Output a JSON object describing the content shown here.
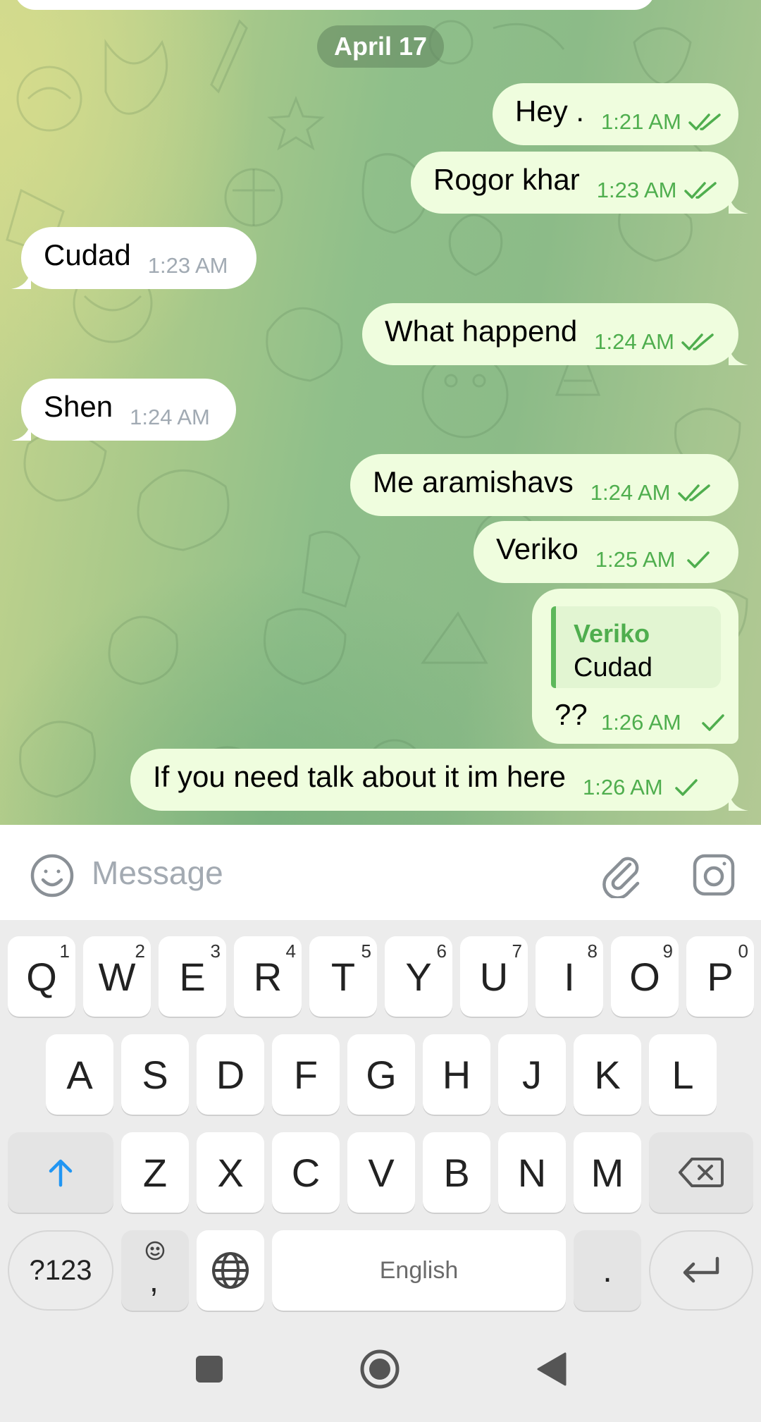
{
  "chat": {
    "date_chip": "April 17",
    "messages": [
      {
        "id": "m1",
        "dir": "out",
        "text": "Hey .",
        "time": "1:21 AM",
        "ticks": "double"
      },
      {
        "id": "m2",
        "dir": "out",
        "text": "Rogor khar",
        "time": "1:23 AM",
        "ticks": "double"
      },
      {
        "id": "m3",
        "dir": "in",
        "text": "Cudad",
        "time": "1:23 AM"
      },
      {
        "id": "m4",
        "dir": "out",
        "text": "What happend",
        "time": "1:24 AM",
        "ticks": "double"
      },
      {
        "id": "m5",
        "dir": "in",
        "text": "Shen",
        "time": "1:24 AM"
      },
      {
        "id": "m6",
        "dir": "out",
        "text": "Me aramishavs",
        "time": "1:24 AM",
        "ticks": "double"
      },
      {
        "id": "m7",
        "dir": "out",
        "text": "Veriko",
        "time": "1:25 AM",
        "ticks": "single"
      },
      {
        "id": "m8",
        "dir": "out",
        "text": "??",
        "time": "1:26 AM",
        "ticks": "single",
        "reply_to": {
          "name": "Veriko",
          "text": "Cudad"
        }
      },
      {
        "id": "m9",
        "dir": "out",
        "text": "If you need talk about it im here",
        "time": "1:26 AM",
        "ticks": "single"
      }
    ]
  },
  "input_bar": {
    "placeholder": "Message",
    "icons": [
      "smile-icon",
      "paperclip-icon",
      "instagram-camera-icon"
    ]
  },
  "keyboard": {
    "row1": [
      {
        "key": "Q",
        "hint": "1"
      },
      {
        "key": "W",
        "hint": "2"
      },
      {
        "key": "E",
        "hint": "3"
      },
      {
        "key": "R",
        "hint": "4"
      },
      {
        "key": "T",
        "hint": "5"
      },
      {
        "key": "Y",
        "hint": "6"
      },
      {
        "key": "U",
        "hint": "7"
      },
      {
        "key": "I",
        "hint": "8"
      },
      {
        "key": "O",
        "hint": "9"
      },
      {
        "key": "P",
        "hint": "0"
      }
    ],
    "row2": [
      "A",
      "S",
      "D",
      "F",
      "G",
      "H",
      "J",
      "K",
      "L"
    ],
    "row3": [
      "Z",
      "X",
      "C",
      "V",
      "B",
      "N",
      "M"
    ],
    "symbols_label": "?123",
    "comma_label": ",",
    "space_label": "English",
    "period_label": ".",
    "shift_icon": "shift-arrow-icon",
    "backspace_icon": "backspace-icon",
    "enter_icon": "enter-icon",
    "globe_icon": "globe-icon"
  },
  "colors": {
    "outgoing_bubble": "#effdde",
    "incoming_bubble": "#ffffff",
    "outgoing_time": "#4fae4e",
    "incoming_time": "#a1aab3",
    "accent_blue": "#2196f3"
  }
}
